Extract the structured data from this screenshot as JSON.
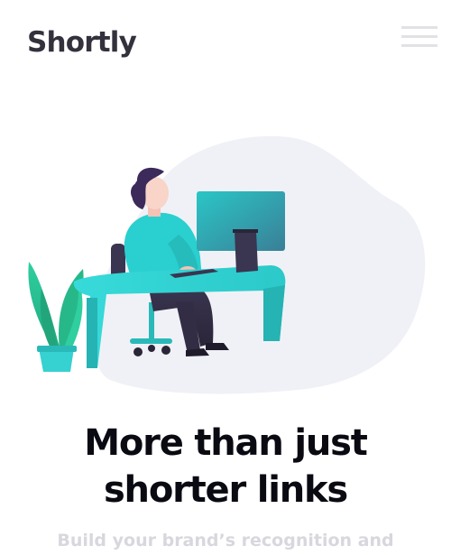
{
  "header": {
    "logo_text": "Shortly",
    "menu_icon": "hamburger-menu-icon"
  },
  "hero": {
    "illustration": "person-working-at-desk-illustration",
    "title_line1": "More than just",
    "title_line2": "shorter links",
    "subtitle": "Build your brand’s recognition and"
  },
  "colors": {
    "logo": "#34313d",
    "menu_lines": "#e2e2e6",
    "blob": "#f0f1f6",
    "teal": "#2acfcf",
    "title": "#0a0a12",
    "subtitle": "#d8d7de"
  }
}
